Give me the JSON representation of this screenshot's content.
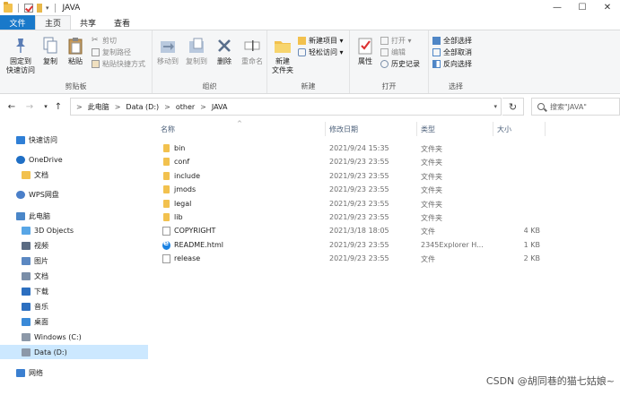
{
  "window": {
    "title": "JAVA",
    "controls": {
      "minimize": "—",
      "maximize": "☐",
      "close": "✕"
    }
  },
  "tabs": [
    "文件",
    "主页",
    "共享",
    "查看"
  ],
  "ribbon": {
    "clipboard": {
      "label": "剪贴板",
      "pin": "固定到\n快速访问",
      "copy": "复制",
      "paste": "粘贴",
      "cut": "剪切",
      "copy_path": "复制路径",
      "paste_shortcut": "粘贴快捷方式"
    },
    "organize": {
      "label": "组织",
      "move_to": "移动到",
      "copy_to": "复制到",
      "delete": "删除",
      "rename": "重命名"
    },
    "new": {
      "label": "新建",
      "new_folder": "新建\n文件夹",
      "new_item": "新建项目 ▾",
      "easy_access": "轻松访问 ▾"
    },
    "open": {
      "label": "打开",
      "properties": "属性",
      "open": "打开 ▾",
      "edit": "编辑",
      "history": "历史记录"
    },
    "select": {
      "label": "选择",
      "select_all": "全部选择",
      "select_none": "全部取消",
      "invert": "反向选择"
    }
  },
  "address": {
    "crumbs": [
      "此电脑",
      "Data (D:)",
      "other",
      "JAVA"
    ],
    "search_placeholder": "搜索\"JAVA\""
  },
  "nav": [
    {
      "label": "快速访问",
      "icon": "star-icon"
    },
    {
      "label": "OneDrive",
      "icon": "cloud-icon"
    },
    {
      "label": "文档",
      "icon": "folder-icon"
    },
    {
      "label": "WPS网盘",
      "icon": "wps-cloud-icon"
    },
    {
      "label": "此电脑",
      "icon": "computer-icon"
    },
    {
      "label": "3D Objects",
      "icon": "cube-icon"
    },
    {
      "label": "视频",
      "icon": "video-icon"
    },
    {
      "label": "图片",
      "icon": "picture-icon"
    },
    {
      "label": "文档",
      "icon": "document-icon"
    },
    {
      "label": "下载",
      "icon": "download-icon"
    },
    {
      "label": "音乐",
      "icon": "music-icon"
    },
    {
      "label": "桌面",
      "icon": "desktop-icon"
    },
    {
      "label": "Windows (C:)",
      "icon": "drive-icon"
    },
    {
      "label": "Data (D:)",
      "icon": "drive-icon",
      "selected": true
    },
    {
      "label": "网络",
      "icon": "network-icon"
    }
  ],
  "columns": {
    "name": "名称",
    "date": "修改日期",
    "type": "类型",
    "size": "大小"
  },
  "files": [
    {
      "name": "bin",
      "date": "2021/9/24 15:35",
      "type": "文件夹",
      "size": "",
      "icon": "folder"
    },
    {
      "name": "conf",
      "date": "2021/9/23 23:55",
      "type": "文件夹",
      "size": "",
      "icon": "folder"
    },
    {
      "name": "include",
      "date": "2021/9/23 23:55",
      "type": "文件夹",
      "size": "",
      "icon": "folder"
    },
    {
      "name": "jmods",
      "date": "2021/9/23 23:55",
      "type": "文件夹",
      "size": "",
      "icon": "folder"
    },
    {
      "name": "legal",
      "date": "2021/9/23 23:55",
      "type": "文件夹",
      "size": "",
      "icon": "folder"
    },
    {
      "name": "lib",
      "date": "2021/9/23 23:55",
      "type": "文件夹",
      "size": "",
      "icon": "folder"
    },
    {
      "name": "COPYRIGHT",
      "date": "2021/3/18 18:05",
      "type": "文件",
      "size": "4 KB",
      "icon": "file"
    },
    {
      "name": "README.html",
      "date": "2021/9/23 23:55",
      "type": "2345Explorer H...",
      "size": "1 KB",
      "icon": "ie"
    },
    {
      "name": "release",
      "date": "2021/9/23 23:55",
      "type": "文件",
      "size": "2 KB",
      "icon": "file"
    }
  ],
  "watermark": "CSDN @胡同巷的猫七姑娘~"
}
